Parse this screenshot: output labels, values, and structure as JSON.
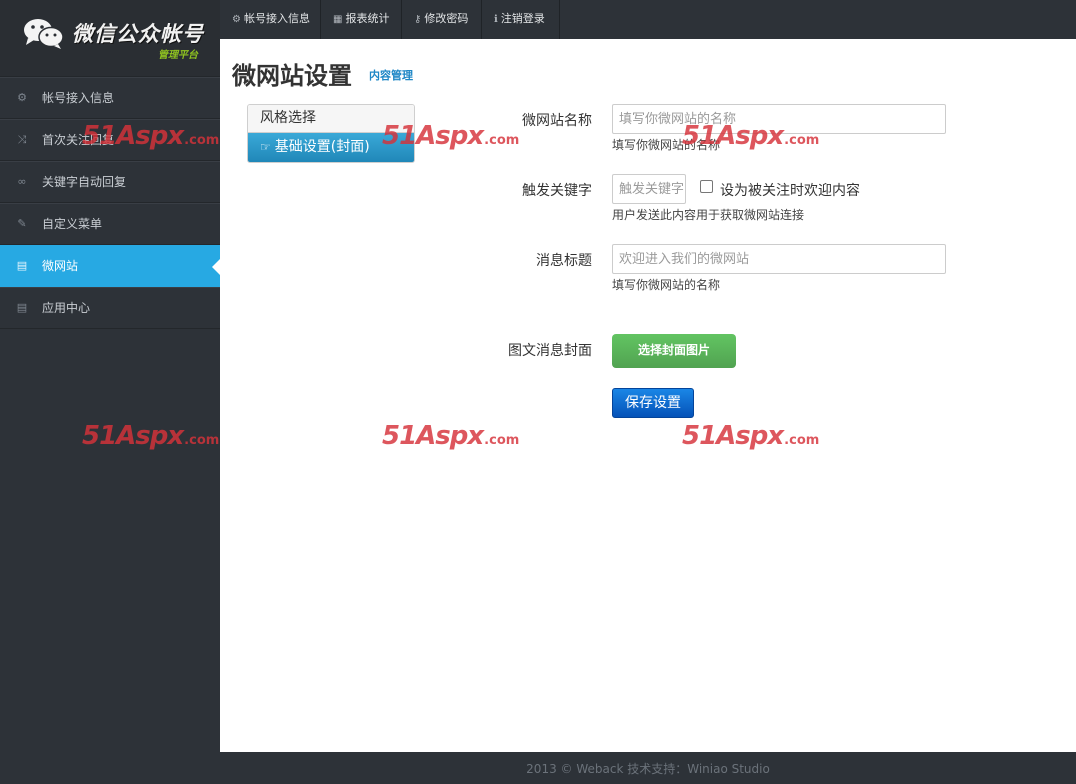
{
  "app": {
    "title": "微信公众帐号",
    "subtitle": "管理平台"
  },
  "sidebar": {
    "items": [
      {
        "label": "帐号接入信息",
        "icon": "gear-icon",
        "glyph": "⚙"
      },
      {
        "label": "首次关注回复",
        "icon": "shuffle-icon",
        "glyph": "⤨"
      },
      {
        "label": "关键字自动回复",
        "icon": "link-icon",
        "glyph": "∞"
      },
      {
        "label": "自定义菜单",
        "icon": "pushpin-icon",
        "glyph": "✎"
      },
      {
        "label": "微网站",
        "icon": "list-icon",
        "glyph": "▤",
        "active": true
      },
      {
        "label": "应用中心",
        "icon": "list-icon",
        "glyph": "▤"
      }
    ]
  },
  "topbar": {
    "items": [
      {
        "label": "帐号接入信息",
        "icon": "gear-icon",
        "glyph": "⚙"
      },
      {
        "label": "报表统计",
        "icon": "grid-icon",
        "glyph": "▦"
      },
      {
        "label": "修改密码",
        "icon": "key-icon",
        "glyph": "⚷"
      },
      {
        "label": "注销登录",
        "icon": "info-icon",
        "glyph": "ℹ"
      }
    ]
  },
  "main": {
    "title": "微网站设置",
    "subtitle": "内容管理",
    "style_panel": {
      "header": "风格选择",
      "active_item": "基础设置(封面)"
    },
    "form": {
      "site_name": {
        "label": "微网站名称",
        "placeholder": "填写你微网站的名称",
        "help": "填写你微网站的名称"
      },
      "keyword": {
        "label": "触发关键字",
        "placeholder": "触发关键字",
        "checkbox_label": "设为被关注时欢迎内容",
        "help": "用户发送此内容用于获取微网站连接"
      },
      "msg_title": {
        "label": "消息标题",
        "placeholder": "欢迎进入我们的微网站",
        "help": "填写你微网站的名称"
      },
      "cover": {
        "label": "图文消息封面",
        "button": "选择封面图片"
      },
      "save_button": "保存设置"
    }
  },
  "footer": {
    "text": "2013 © Weback    技术支持：Winiao Studio"
  },
  "watermark": {
    "main": "51Aspx",
    "suffix": ".com"
  },
  "colors": {
    "sidebar_bg": "#2d3238",
    "active": "#27a9e3",
    "green_button": "#5bb75b",
    "blue_button": "#0a6ccf",
    "link": "#1e87c6"
  }
}
